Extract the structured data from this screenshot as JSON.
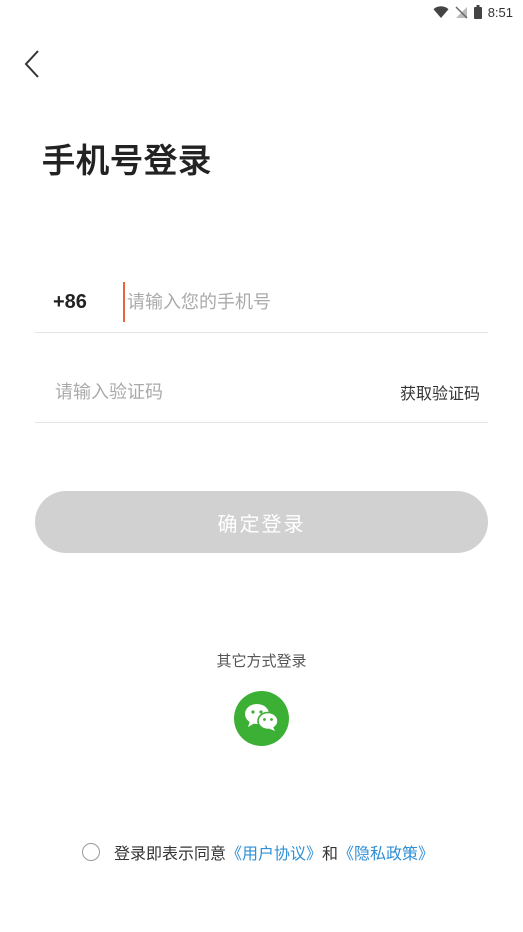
{
  "status_bar": {
    "time": "8:51"
  },
  "header": {
    "title": "手机号登录"
  },
  "phone_field": {
    "country_code": "+86",
    "placeholder": "请输入您的手机号"
  },
  "code_field": {
    "placeholder": "请输入验证码",
    "get_code_label": "获取验证码"
  },
  "confirm_button": {
    "label": "确定登录"
  },
  "other_login": {
    "label": "其它方式登录",
    "icon": "wechat-icon"
  },
  "agreement": {
    "prefix": "登录即表示同意",
    "user_agreement": "《用户协议》",
    "conjunction": "和",
    "privacy_policy": "《隐私政策》"
  },
  "colors": {
    "wechat_green": "#3cb034",
    "link_blue": "#2f8fd6",
    "button_disabled": "#d1d1d1",
    "caret": "#e8643a"
  }
}
